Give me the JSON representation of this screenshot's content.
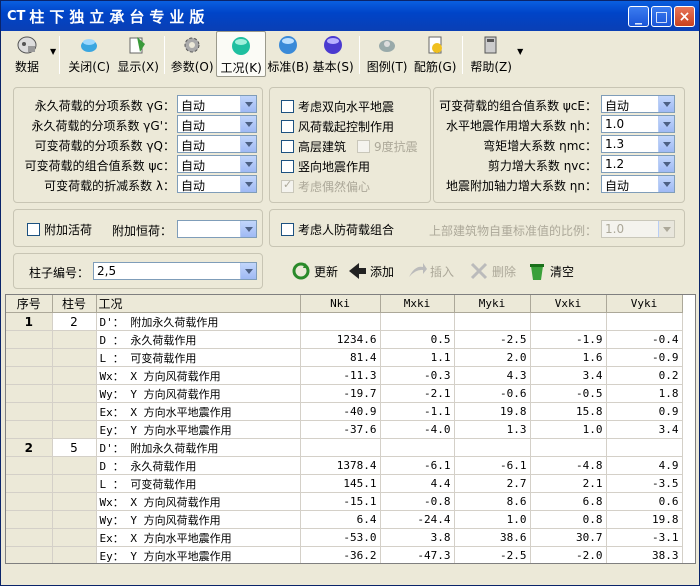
{
  "title": {
    "logo": "CT",
    "text": "柱下独立承台专业版"
  },
  "toolbar": [
    {
      "name": "data",
      "label": "数据",
      "icon": "data-icon",
      "dropdown": true
    },
    {
      "name": "close",
      "label": "关闭(C)",
      "icon": "close-doc-icon"
    },
    {
      "name": "display",
      "label": "显示(X)",
      "icon": "display-icon"
    },
    {
      "name": "params",
      "label": "参数(O)",
      "icon": "gear-icon"
    },
    {
      "name": "case",
      "label": "工况(K)",
      "icon": "case-icon",
      "active": true
    },
    {
      "name": "standard",
      "label": "标准(B)",
      "icon": "standard-icon"
    },
    {
      "name": "basic",
      "label": "基本(S)",
      "icon": "basic-icon"
    },
    {
      "name": "legend",
      "label": "图例(T)",
      "icon": "legend-icon"
    },
    {
      "name": "rebar",
      "label": "配筋(G)",
      "icon": "rebar-icon"
    },
    {
      "name": "help",
      "label": "帮助(Z)",
      "icon": "help-icon",
      "dropdown": true
    }
  ],
  "factors_left": [
    {
      "label": "永久荷载的分项系数 γG：",
      "value": "自动"
    },
    {
      "label": "永久荷载的分项系数 γG'：",
      "value": "自动"
    },
    {
      "label": "可变荷载的分项系数 γQ：",
      "value": "自动"
    },
    {
      "label": "可变荷载的组合值系数 ψc：",
      "value": "自动"
    },
    {
      "label": "可变荷载的折减系数 λ：",
      "value": "自动"
    }
  ],
  "options_mid": [
    {
      "label": "考虑双向水平地震",
      "checked": false,
      "disabled": false
    },
    {
      "label": "风荷载起控制作用",
      "checked": false,
      "disabled": false
    },
    {
      "label": "高层建筑",
      "checked": false,
      "disabled": false
    },
    {
      "label": "9度抗震",
      "checked": false,
      "disabled": true
    },
    {
      "label": "竖向地震作用",
      "checked": false,
      "disabled": false
    },
    {
      "label": "考虑偶然偏心",
      "checked": true,
      "disabled": true
    }
  ],
  "factors_right": [
    {
      "label": "可变荷载的组合值系数 ψcE：",
      "value": "自动"
    },
    {
      "label": "水平地震作用增大系数 ηh：",
      "value": "1.0"
    },
    {
      "label": "弯矩增大系数 ηmc：",
      "value": "1.3"
    },
    {
      "label": "剪力增大系数 ηvc：",
      "value": "1.2"
    },
    {
      "label": "地震附加轴力增大系数 ηn：",
      "value": "自动"
    }
  ],
  "extra": {
    "add_live": "附加活荷",
    "add_dead_label": "附加恒荷：",
    "add_dead_value": "",
    "civil_defense": "考虑人防荷载组合",
    "ratio_label": "上部建筑物自重标准值的比例：",
    "ratio_value": "1.0"
  },
  "column": {
    "label": "柱子编号：",
    "value": "2,5"
  },
  "actions": [
    {
      "name": "refresh",
      "label": "更新",
      "disabled": false
    },
    {
      "name": "add",
      "label": "添加",
      "disabled": false
    },
    {
      "name": "insert",
      "label": "插入",
      "disabled": true
    },
    {
      "name": "delete",
      "label": "删除",
      "disabled": true
    },
    {
      "name": "clear",
      "label": "清空",
      "disabled": false
    }
  ],
  "table": {
    "headers": [
      "序号",
      "柱号",
      "工况",
      "Nki",
      "Mxki",
      "Myki",
      "Vxki",
      "Vyki"
    ],
    "groups": [
      {
        "seq": "1",
        "col": "2",
        "rows": [
          {
            "case": "D'： 附加永久荷载作用",
            "v": [
              "",
              "",
              "",
              "",
              ""
            ]
          },
          {
            "case": "D ： 永久荷载作用",
            "v": [
              "1234.6",
              "0.5",
              "-2.5",
              "-1.9",
              "-0.4"
            ]
          },
          {
            "case": "L ： 可变荷载作用",
            "v": [
              "81.4",
              "1.1",
              "2.0",
              "1.6",
              "-0.9"
            ]
          },
          {
            "case": "Wx： X 方向风荷载作用",
            "v": [
              "-11.3",
              "-0.3",
              "4.3",
              "3.4",
              "0.2"
            ]
          },
          {
            "case": "Wy： Y 方向风荷载作用",
            "v": [
              "-19.7",
              "-2.1",
              "-0.6",
              "-0.5",
              "1.8"
            ]
          },
          {
            "case": "Ex： X 方向水平地震作用",
            "v": [
              "-40.9",
              "-1.1",
              "19.8",
              "15.8",
              "0.9"
            ]
          },
          {
            "case": "Ey： Y 方向水平地震作用",
            "v": [
              "-37.6",
              "-4.0",
              "1.3",
              "1.0",
              "3.4"
            ]
          }
        ]
      },
      {
        "seq": "2",
        "col": "5",
        "rows": [
          {
            "case": "D'： 附加永久荷载作用",
            "v": [
              "",
              "",
              "",
              "",
              ""
            ]
          },
          {
            "case": "D ： 永久荷载作用",
            "v": [
              "1378.4",
              "-6.1",
              "-6.1",
              "-4.8",
              "4.9"
            ]
          },
          {
            "case": "L ： 可变荷载作用",
            "v": [
              "145.1",
              "4.4",
              "2.7",
              "2.1",
              "-3.5"
            ]
          },
          {
            "case": "Wx： X 方向风荷载作用",
            "v": [
              "-15.1",
              "-0.8",
              "8.6",
              "6.8",
              "0.6"
            ]
          },
          {
            "case": "Wy： Y 方向风荷载作用",
            "v": [
              "6.4",
              "-24.4",
              "1.0",
              "0.8",
              "19.8"
            ]
          },
          {
            "case": "Ex： X 方向水平地震作用",
            "v": [
              "-53.0",
              "3.8",
              "38.6",
              "30.7",
              "-3.1"
            ]
          },
          {
            "case": "Ey： Y 方向水平地震作用",
            "v": [
              "-36.2",
              "-47.3",
              "-2.5",
              "-2.0",
              "38.3"
            ]
          }
        ]
      }
    ]
  }
}
